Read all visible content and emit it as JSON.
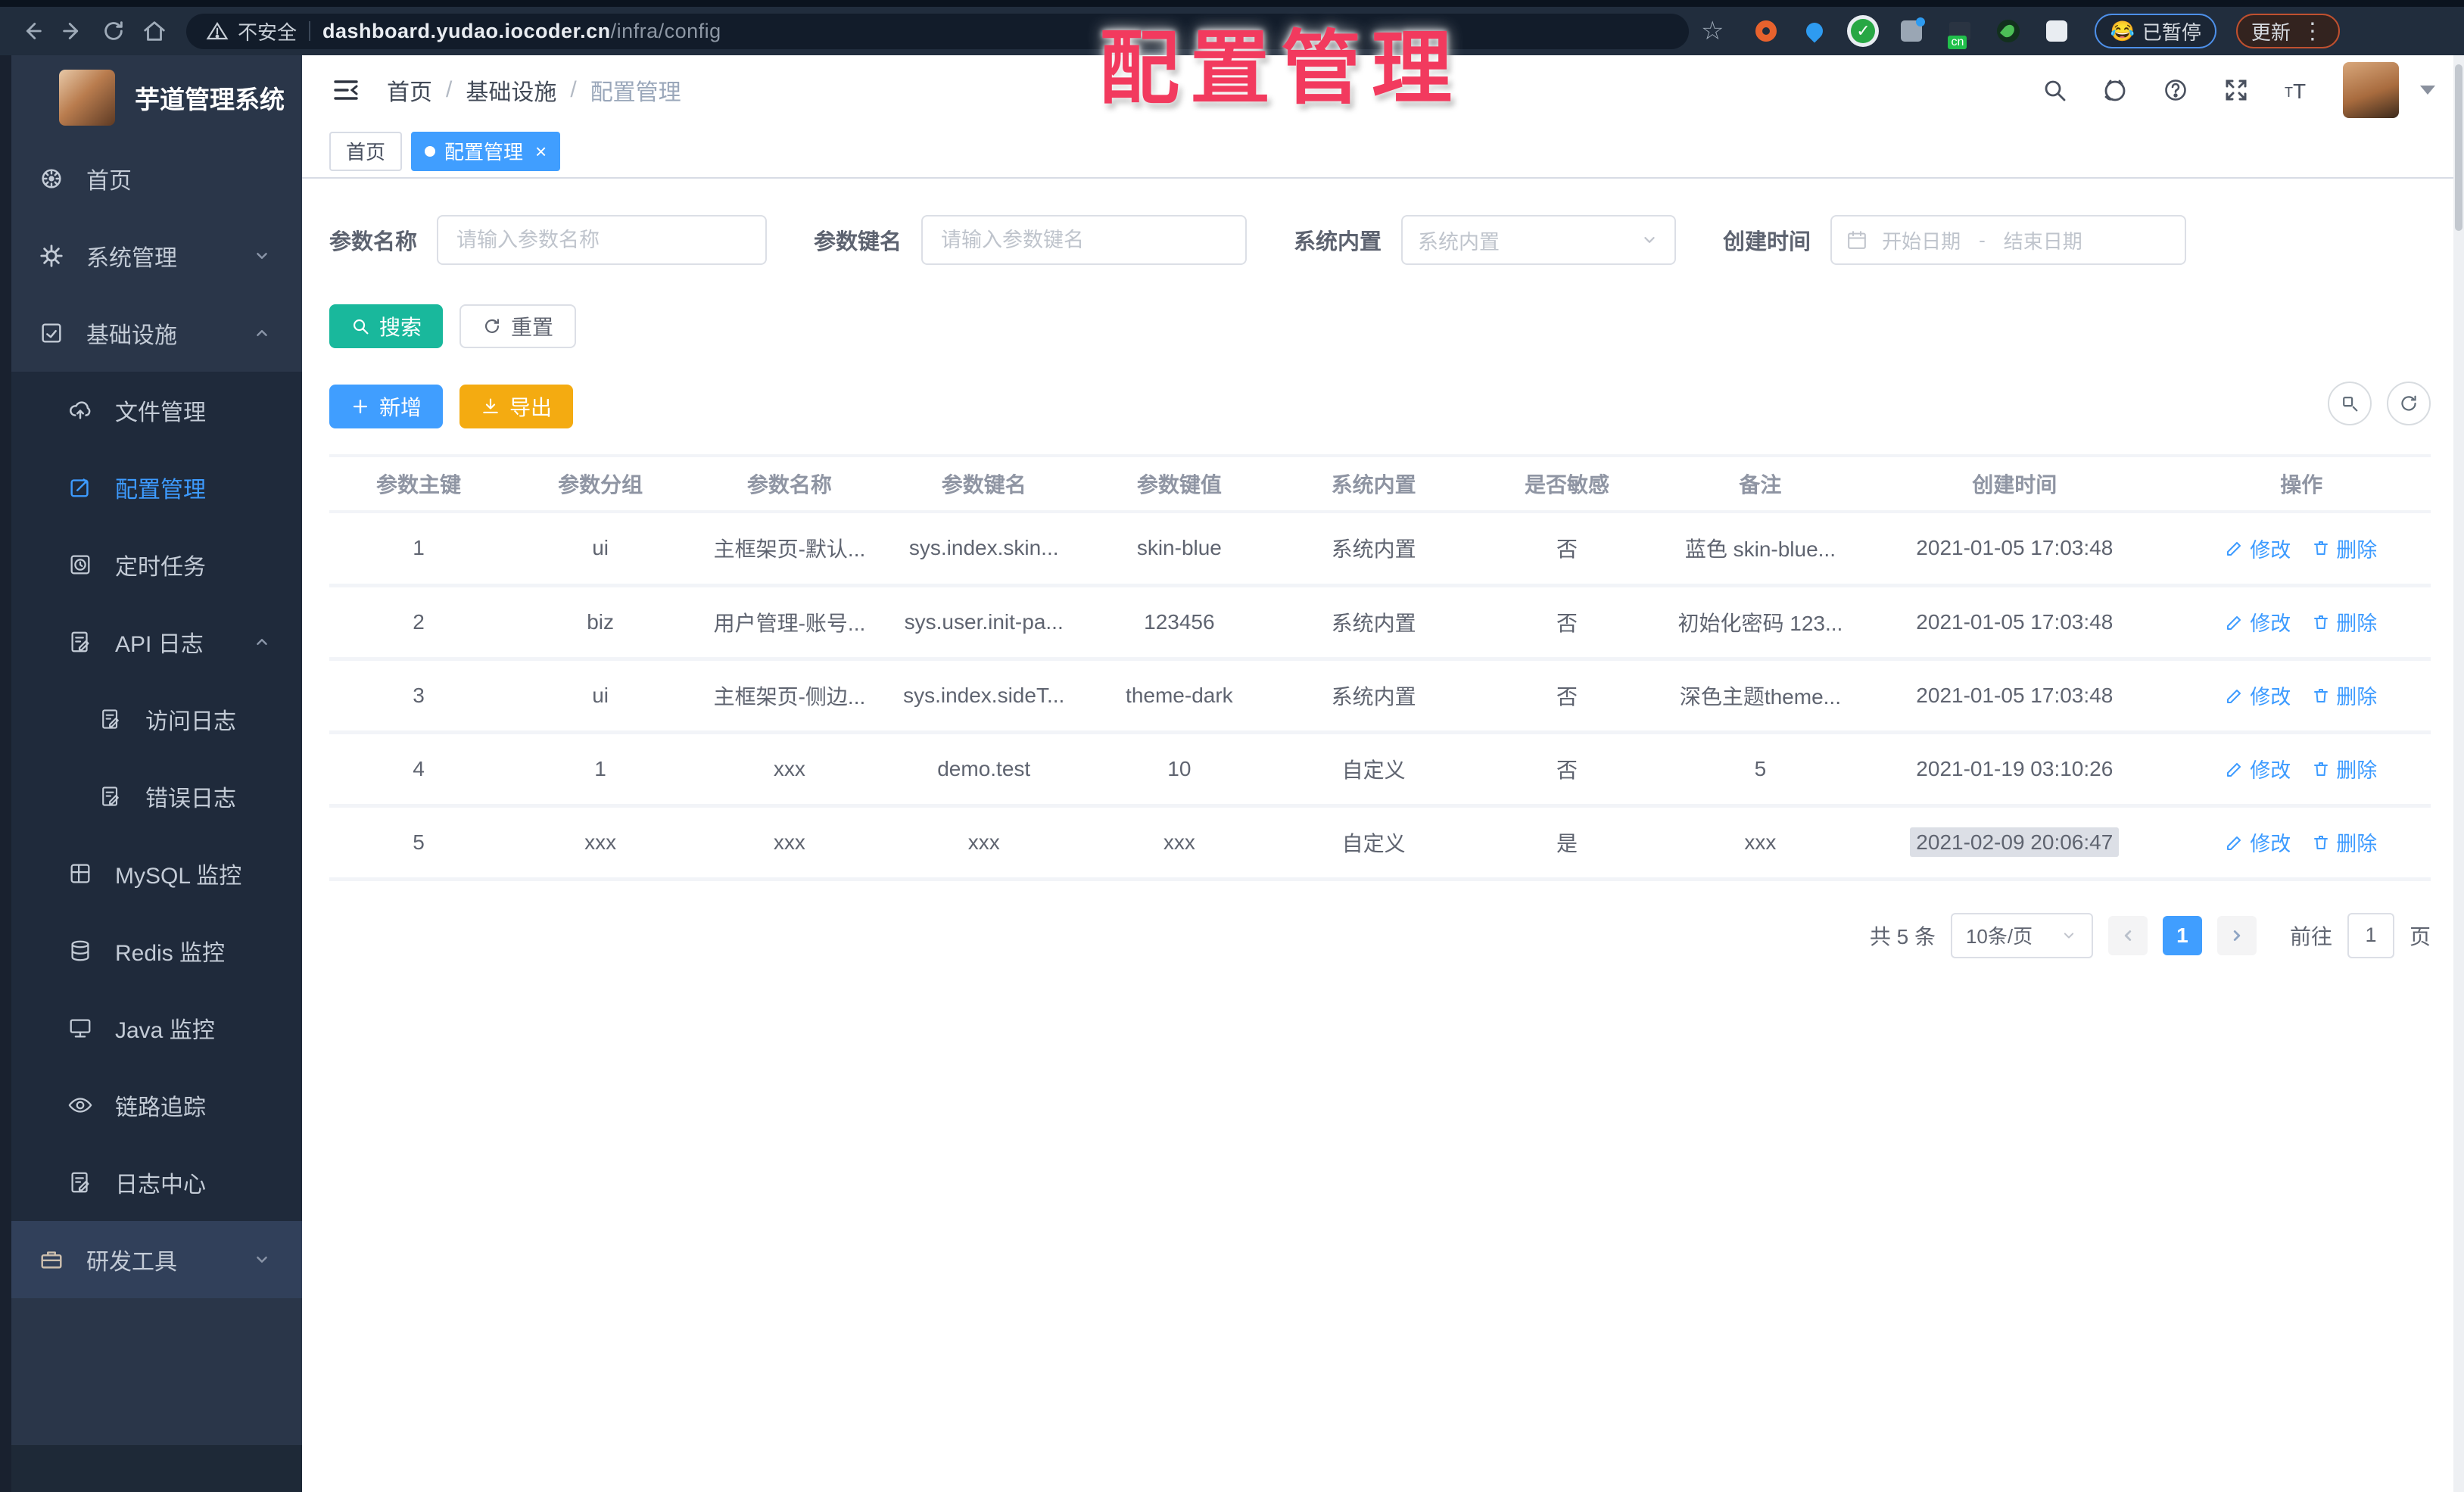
{
  "watermark": {
    "text": "配置管理",
    "color": "#f23a5e"
  },
  "browser": {
    "security_label": "不安全",
    "url_host": "dashboard.yudao.iocoder.cn",
    "url_path": "/infra/config",
    "paused_emoji": "😂",
    "paused_label": "已暂停",
    "update_label": "更新"
  },
  "sidebar": {
    "title": "芋道管理系统",
    "menu": [
      {
        "label": "首页",
        "icon": "home-icon"
      },
      {
        "label": "系统管理",
        "icon": "gear-icon"
      },
      {
        "label": "基础设施",
        "icon": "infrastructure-icon"
      },
      {
        "label": "文件管理",
        "icon": "cloud-upload-icon"
      },
      {
        "label": "配置管理",
        "icon": "edit-square-icon",
        "active": true
      },
      {
        "label": "定时任务",
        "icon": "schedule-icon"
      },
      {
        "label": "API 日志",
        "icon": "api-log-icon"
      },
      {
        "label": "访问日志",
        "icon": "access-log-icon"
      },
      {
        "label": "错误日志",
        "icon": "error-log-icon"
      },
      {
        "label": "MySQL 监控",
        "icon": "mysql-icon"
      },
      {
        "label": "Redis 监控",
        "icon": "redis-icon"
      },
      {
        "label": "Java 监控",
        "icon": "java-icon"
      },
      {
        "label": "链路追踪",
        "icon": "eye-icon"
      },
      {
        "label": "日志中心",
        "icon": "log-center-icon"
      },
      {
        "label": "研发工具",
        "icon": "toolbox-icon"
      }
    ]
  },
  "header": {
    "breadcrumb": [
      "首页",
      "基础设施",
      "配置管理"
    ]
  },
  "tabs": [
    {
      "label": "首页"
    },
    {
      "label": "配置管理",
      "active": true
    }
  ],
  "filters": {
    "name": {
      "label": "参数名称",
      "placeholder": "请输入参数名称"
    },
    "key": {
      "label": "参数键名",
      "placeholder": "请输入参数键名"
    },
    "type": {
      "label": "系统内置",
      "placeholder": "系统内置"
    },
    "date": {
      "label": "创建时间",
      "start": "开始日期",
      "separator": "-",
      "end": "结束日期"
    }
  },
  "toolbar": {
    "search": "搜索",
    "reset": "重置",
    "add": "新增",
    "export": "导出"
  },
  "table": {
    "columns": [
      "参数主键",
      "参数分组",
      "参数名称",
      "参数键名",
      "参数键值",
      "系统内置",
      "是否敏感",
      "备注",
      "创建时间",
      "操作"
    ],
    "edit_label": "修改",
    "delete_label": "删除",
    "rows": [
      {
        "cells": [
          "1",
          "ui",
          "主框架页-默认...",
          "sys.index.skin...",
          "skin-blue",
          "系统内置",
          "否",
          "蓝色 skin-blue...",
          "2021-01-05 17:03:48"
        ]
      },
      {
        "cells": [
          "2",
          "biz",
          "用户管理-账号...",
          "sys.user.init-pa...",
          "123456",
          "系统内置",
          "否",
          "初始化密码 123...",
          "2021-01-05 17:03:48"
        ]
      },
      {
        "cells": [
          "3",
          "ui",
          "主框架页-侧边...",
          "sys.index.sideT...",
          "theme-dark",
          "系统内置",
          "否",
          "深色主题theme...",
          "2021-01-05 17:03:48"
        ]
      },
      {
        "cells": [
          "4",
          "1",
          "xxx",
          "demo.test",
          "10",
          "自定义",
          "否",
          "5",
          "2021-01-19 03:10:26"
        ]
      },
      {
        "cells": [
          "5",
          "xxx",
          "xxx",
          "xxx",
          "xxx",
          "自定义",
          "是",
          "xxx",
          "2021-02-09 20:06:47"
        ]
      }
    ]
  },
  "pagination": {
    "total": "共 5 条",
    "page_size": "10条/页",
    "current": "1",
    "goto_label": "前往",
    "goto_value": "1",
    "unit": "页"
  }
}
